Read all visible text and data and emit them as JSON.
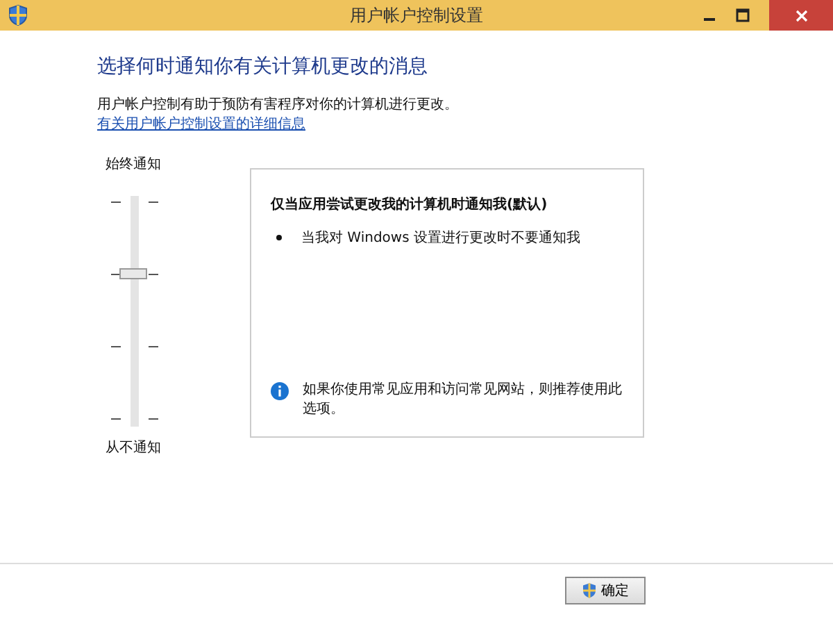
{
  "window": {
    "title": "用户帐户控制设置"
  },
  "heading": "选择何时通知你有关计算机更改的消息",
  "description": "用户帐户控制有助于预防有害程序对你的计算机进行更改。",
  "link": "有关用户帐户控制设置的详细信息",
  "slider": {
    "top_label": "始终通知",
    "bottom_label": "从不通知",
    "level": 0.667
  },
  "info_box": {
    "title": "仅当应用尝试更改我的计算机时通知我(默认)",
    "bullets": [
      "当我对 Windows 设置进行更改时不要通知我"
    ],
    "note": "如果你使用常见应用和访问常见网站，则推荐使用此选项。"
  },
  "buttons": [
    "确定"
  ]
}
